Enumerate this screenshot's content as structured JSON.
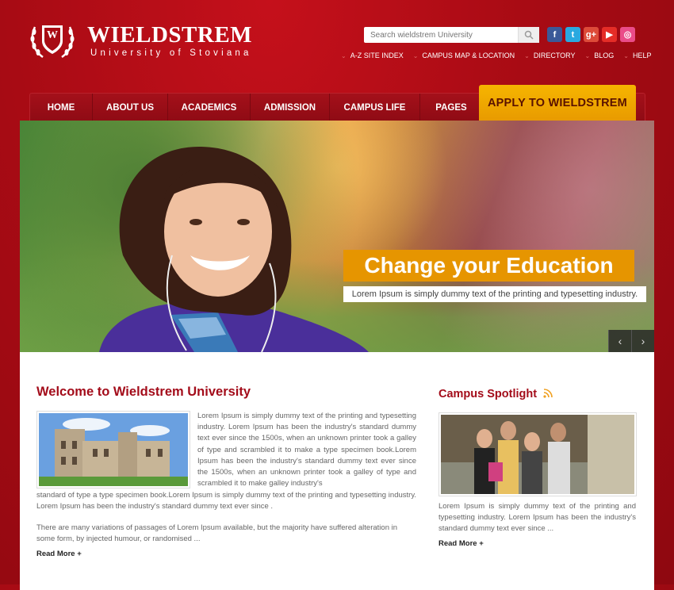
{
  "brand": {
    "name": "WIELDSTREM",
    "subtitle": "University of Stoviana",
    "crest_letter": "W"
  },
  "search": {
    "placeholder": "Search wieldstrem University"
  },
  "social": [
    {
      "icon": "facebook-icon",
      "glyph": "f",
      "color": "#3b5998"
    },
    {
      "icon": "twitter-icon",
      "glyph": "t",
      "color": "#2aa9e0"
    },
    {
      "icon": "googleplus-icon",
      "glyph": "g+",
      "color": "#dd4b39"
    },
    {
      "icon": "youtube-icon",
      "glyph": "▶",
      "color": "#e52d27"
    },
    {
      "icon": "dribbble-icon",
      "glyph": "◎",
      "color": "#ea4c89"
    }
  ],
  "top_links": [
    "A-Z SITE INDEX",
    "CAMPUS MAP & LOCATION",
    "DIRECTORY",
    "BLOG",
    "HELP"
  ],
  "nav": [
    {
      "label": "HOME"
    },
    {
      "label": "ABOUT US"
    },
    {
      "label": "ACADEMICS"
    },
    {
      "label": "ADMISSION"
    },
    {
      "label": "CAMPUS LIFE"
    },
    {
      "label": "PAGES"
    }
  ],
  "apply_label": "APPLY TO WIELDSTREM",
  "slide": {
    "title": "Change your Education",
    "caption": "Lorem Ipsum is simply dummy text of the printing and typesetting industry.",
    "prev": "‹",
    "next": "›"
  },
  "welcome": {
    "title": "Welcome to Wieldstrem University",
    "para1": "Lorem Ipsum is simply dummy text of the printing and typesetting industry. Lorem Ipsum has been the industry's standard dummy text ever since the 1500s, when an unknown printer took a galley of type and scrambled it to make a type specimen book.Lorem Ipsum has been the industry's standard dummy text ever since the 1500s, when an unknown printer took a galley of type and scrambled it to make galley industry's",
    "para1b": "standard of type a type specimen book.Lorem Ipsum is simply dummy text of the printing and typesetting industry. Lorem Ipsum has been the industry's standard dummy text ever since .",
    "para2": "There are many variations of passages of Lorem Ipsum available, but the majority have suffered alteration in some form, by injected humour, or randomised ...",
    "read_more": "Read More +"
  },
  "spotlight": {
    "title": "Campus Spotlight",
    "text": "Lorem Ipsum is simply dummy text of the printing and typesetting industry. Lorem Ipsum has been the industry's standard dummy text ever since ...",
    "read_more": "Read More +"
  }
}
